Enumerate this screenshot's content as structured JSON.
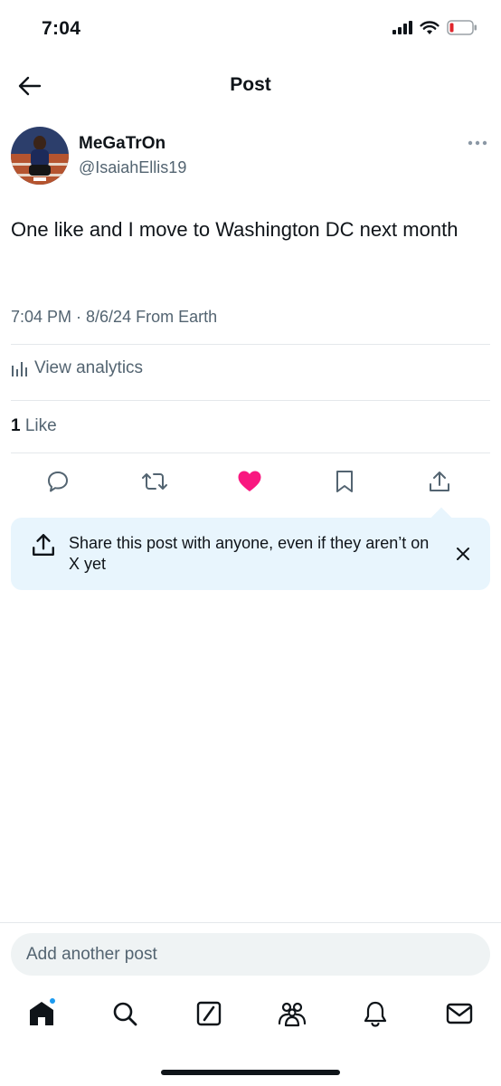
{
  "status_bar": {
    "time": "7:04"
  },
  "header": {
    "title": "Post"
  },
  "author": {
    "display_name": "MeGaTrOn",
    "handle": "@IsaiahEllis19"
  },
  "post": {
    "text": "One like and I move to Washington DC next month",
    "meta": "7:04 PM · 8/6/24 From Earth",
    "analytics_label": "View analytics",
    "like_count": "1",
    "like_label": "Like"
  },
  "actions": [
    "reply",
    "repost",
    "like",
    "bookmark",
    "share"
  ],
  "toast": {
    "text": "Share this post with anyone, even if they aren’t on X yet"
  },
  "composer": {
    "placeholder": "Add another post"
  },
  "tabbar": [
    "home",
    "search",
    "grok",
    "communities",
    "notifications",
    "messages"
  ],
  "colors": {
    "accent": "#1d9bf0",
    "like": "#f91880",
    "secondary_text": "#536471",
    "toast_bg": "#e8f5fd"
  }
}
